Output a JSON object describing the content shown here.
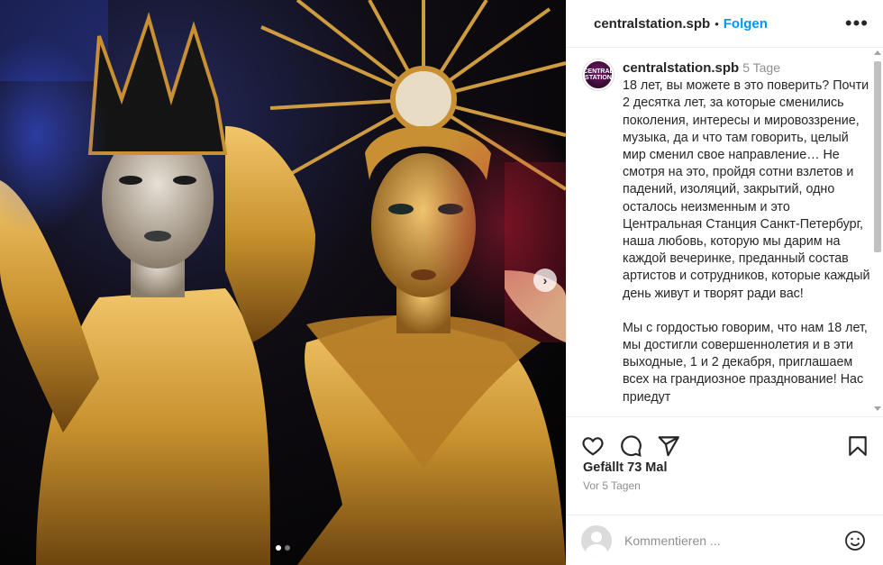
{
  "post": {
    "image_alt": "Two performers in gold costumes, crowns and makeup",
    "carousel": {
      "count": 2,
      "active_index": 1,
      "next_label": "›"
    }
  },
  "header": {
    "username": "centralstation.spb",
    "separator": "•",
    "follow_label": "Folgen",
    "more_label": "•••"
  },
  "caption": {
    "username": "centralstation.spb",
    "age": "5 Tage",
    "avatar_text": "CENTRAL STATION",
    "paragraph1": "18 лет, вы можете в это поверить? Почти 2 десятка лет, за которые сменились поколения, интересы и мировоззрение, музыка, да и что там говорить, целый мир сменил свое направление… Не смотря на это, пройдя сотни взлетов и падений, изоляций, закрытий, одно осталось неизменным и это Центральная Станция Санкт-Петербург, наша любовь, которую мы дарим на каждой вечеринке, преданный состав артистов и сотрудников, которые каждый день живут и творят ради вас!",
    "paragraph2": "Мы с гордостью говорим, что нам 18 лет, мы достигли совершеннолетия и в эти выходные, 1 и 2 декабря, приглашаем всех на грандиозное празднование! Нас приедут"
  },
  "icons": {
    "like": "heart-icon",
    "comment": "comment-icon",
    "share": "share-icon",
    "save": "bookmark-icon",
    "emoji": "emoji-icon"
  },
  "likes_text": "Gefällt 73 Mal",
  "time_text": "Vor 5 Tagen",
  "comment_input": {
    "placeholder": "Kommentieren ..."
  },
  "colors": {
    "accent": "#0095f6",
    "text": "#262626",
    "muted": "#8e8e8e"
  }
}
